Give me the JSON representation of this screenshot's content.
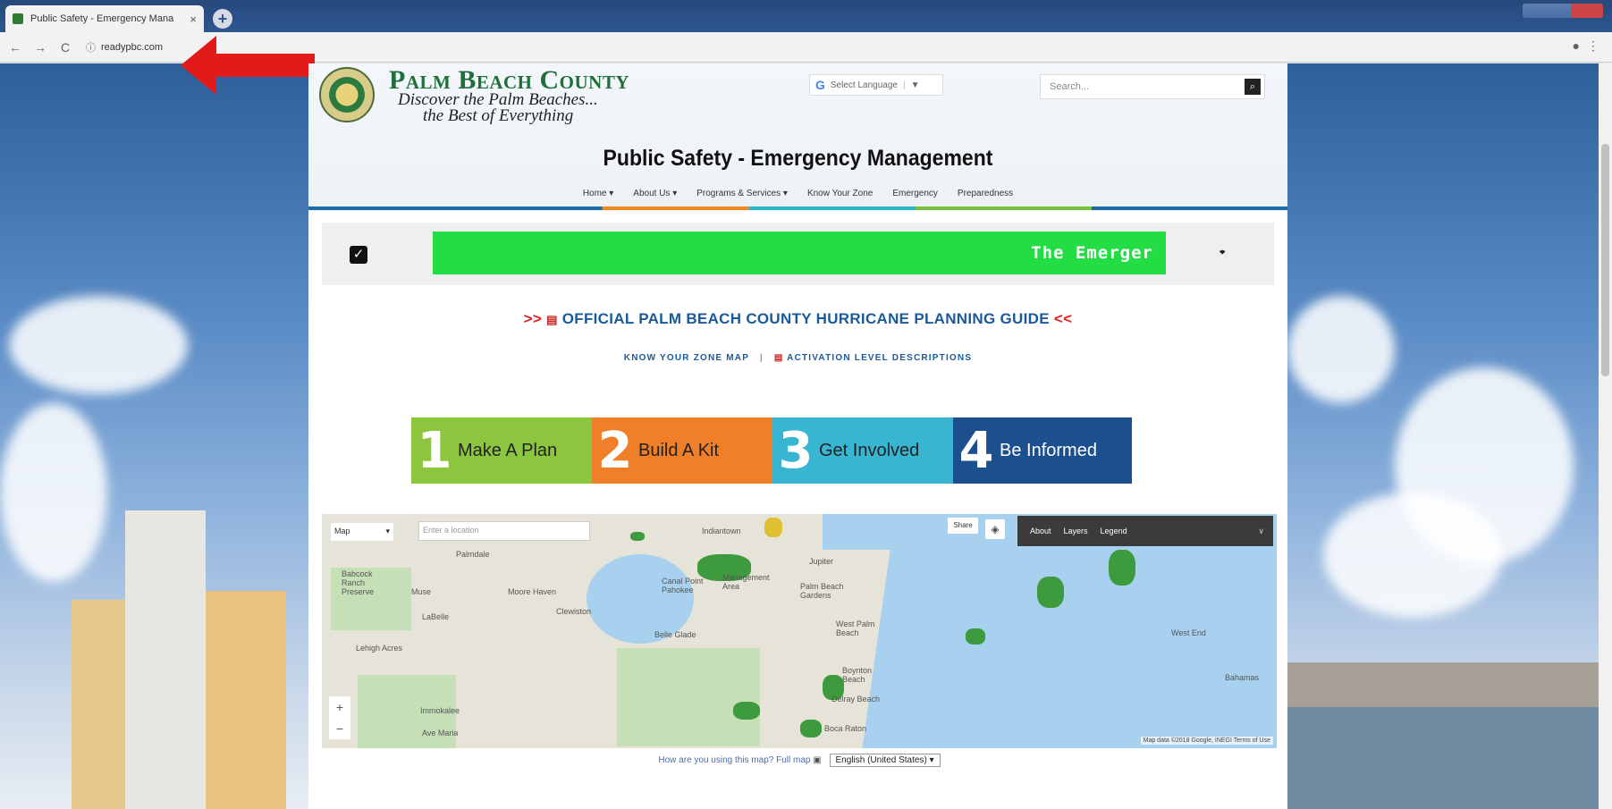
{
  "browser": {
    "tab_title": "Public Safety - Emergency Mana",
    "tab_close": "×",
    "new_tab": "+",
    "url": "readypbc.com",
    "back": "←",
    "forward": "→",
    "reload": "C"
  },
  "header": {
    "county_name": "Palm Beach County",
    "tagline_1": "Discover the Palm Beaches...",
    "tagline_2": "the Best of Everything",
    "translate_label": "Select Language",
    "search_placeholder": "Search...",
    "site_title": "Public Safety - Emergency Management"
  },
  "nav": {
    "items": [
      {
        "label": "Home ▾"
      },
      {
        "label": "About Us ▾"
      },
      {
        "label": "Programs & Services ▾"
      },
      {
        "label": "Know Your Zone"
      },
      {
        "label": "Emergency"
      },
      {
        "label": "Preparedness"
      }
    ]
  },
  "alert": {
    "ticker_text": "The Emerger"
  },
  "guide": {
    "left_chevrons": ">>",
    "text": "OFFICIAL PALM BEACH COUNTY HURRICANE PLANNING GUIDE",
    "right_chevrons": "<<"
  },
  "links": {
    "zone_map": "KNOW YOUR ZONE MAP",
    "separator": "|",
    "activation": "ACTIVATION LEVEL DESCRIPTIONS"
  },
  "tiles": [
    {
      "number": "1",
      "label": "Make A Plan",
      "color": "#8cc63e"
    },
    {
      "number": "2",
      "label": "Build A Kit",
      "color": "#f07f2a"
    },
    {
      "number": "3",
      "label": "Get Involved",
      "color": "#38b6d1"
    },
    {
      "number": "4",
      "label": "Be Informed",
      "color": "#1c4f8d"
    }
  ],
  "map": {
    "type_select": "Map",
    "location_placeholder": "Enter a location",
    "share": "Share",
    "panel": {
      "about": "About",
      "layers": "Layers",
      "legend": "Legend"
    },
    "zoom_in": "+",
    "zoom_out": "−",
    "attribution": "Map data ©2018 Google, INEGI   Terms of Use",
    "labels": {
      "palmdale": "Palmdale",
      "babcock": "Babcock Ranch Preserve",
      "muse": "Muse",
      "labelle": "LaBelle",
      "moore_haven": "Moore Haven",
      "clewiston": "Clewiston",
      "lehigh": "Lehigh Acres",
      "immokalee": "Immokalee",
      "ave_maria": "Ave Maria",
      "indiantown": "Indiantown",
      "canal_point": "Canal Point Pahokee",
      "jdwildlife": "Management Area",
      "belle_glade": "Belle Glade",
      "jupiter": "Jupiter",
      "pbg": "Palm Beach Gardens",
      "wpb": "West Palm Beach",
      "boynton": "Boynton Beach",
      "delray": "Delray Beach",
      "boca": "Boca Raton",
      "west_end": "West End",
      "bahamas": "Bahamas"
    }
  },
  "map_footer": {
    "feedback": "How are you using this map?",
    "full_map": "Full map",
    "language": "English (United States)"
  }
}
